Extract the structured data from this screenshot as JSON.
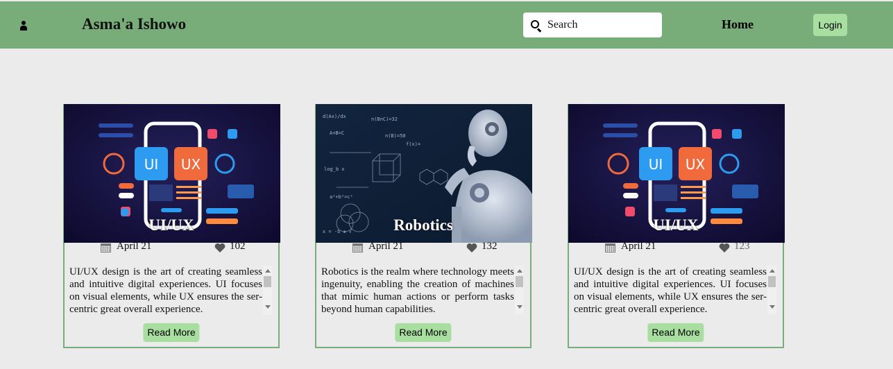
{
  "navbar": {
    "brand": "Asma'a Ishowo",
    "search_placeholder": "Search",
    "home_label": "Home",
    "login_label": "Login",
    "bg_color": "#78ac78"
  },
  "cards": [
    {
      "title": "UI/UX",
      "date": "April 21",
      "likes": "102",
      "description": "UI/UX design is the art of creating seamless and intuitive digital experiences. UI focuses on visual elements, while UX ensures the ser-centric great overall experience.",
      "button": "Read More",
      "image": "ui-ux-phone-illustration"
    },
    {
      "title": "Robotics",
      "date": "April 21",
      "likes": "132",
      "description": "Robotics is the realm where technology meets ingenuity, enabling the creation of machines that mimic human actions or perform tasks beyond human capabilities.",
      "button": "Read More",
      "image": "humanoid-robot-thinking"
    },
    {
      "title": "UI/UX",
      "date": "April 21",
      "likes": "123",
      "description": "UI/UX design is the art of creating seamless and intuitive digital experiences. UI focuses on visual elements, while UX ensures the ser-centric great overall experience.",
      "button": "Read More",
      "image": "ui-ux-phone-illustration"
    }
  ]
}
